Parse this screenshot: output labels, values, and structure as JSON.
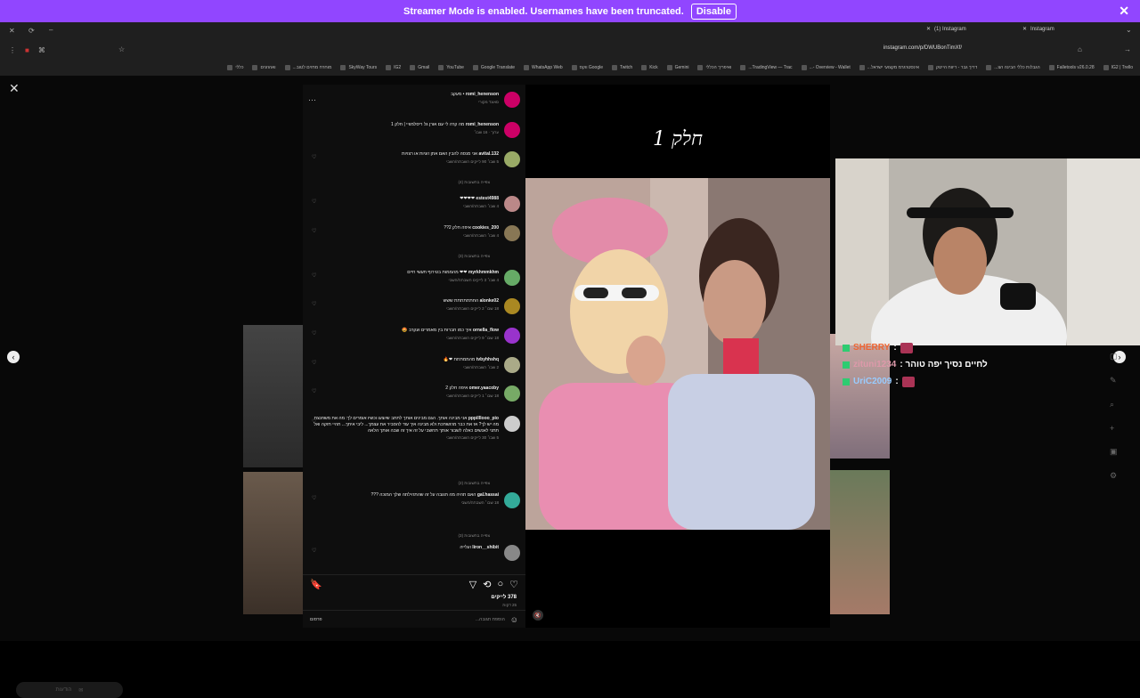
{
  "banner": {
    "message": "Streamer Mode is enabled. Usernames have been truncated.",
    "button_label": "Disable",
    "close": "✕"
  },
  "browser": {
    "tabs": [
      "(1) Instagram",
      "Instagram"
    ],
    "url": "instagram.com/p/DWUBonTimXf/",
    "bookmarks": [
      "IG2 | Trello",
      "Falletools v26.0.28",
      "הגבלות כללי הבינה הצ...",
      "דריך גבר - ריווח הייטק",
      "אינסטרגרמ מקצועי ישראל...",
      "Overview - Wallet -...",
      "TradingView — Trac...",
      "ואיפריך הכללי",
      "Gemini",
      "Kick",
      "Twitch",
      "Google ווקס",
      "WhatsApp Web",
      "Google Translate",
      "YouTube",
      "Gmail",
      "IG2",
      "SkyWay Tours",
      "מוחרח מחזים לטוב...",
      "ואהוזנים",
      "כללי"
    ]
  },
  "post": {
    "caption": "חלק 1",
    "likes": "378 לייקים",
    "ago": "25 דקות",
    "add_comment_placeholder": "הוספת תגובה...",
    "post_label": "פרסום"
  },
  "comments": [
    {
      "user": "romi_henenson",
      "text": "• מעקב",
      "meta": "סאונד מקורי",
      "color": "#c06"
    },
    {
      "user": "romi_henenson",
      "text": "מה קרה לי עם אורן גל ריסלמוויי | חלק 1",
      "meta": "ערוך · 16 שבו׳",
      "color": "#c06"
    },
    {
      "user": "avital.132",
      "text": "אני מנסה להבין האם אתן זוגיות או רצויות",
      "meta": "5 שבו׳ 90 לייקים השבתה/השבי",
      "color": "#9a6"
    },
    {
      "user": "estest4988",
      "text": "❤❤❤❤",
      "meta": "4 שבו׳ השבתה/השבי",
      "color": "#b88"
    },
    {
      "user": "cookies_200",
      "text": "איפה חלק 2??",
      "meta": "4 שבו׳ השבתה/השבי",
      "color": "#875"
    },
    {
      "user": "myrkhmmkhm",
      "text": "❤❤ מהממות בטירוף תעשי חיים",
      "meta": "4 שבו׳ 3 לייקים השבתה/השבי",
      "color": "#6a6"
    },
    {
      "user": "alonke02",
      "text": "החתתתתתת ששש",
      "meta": "18 שבו׳ 2 לייקים השבתה/השבי",
      "color": "#a82"
    },
    {
      "user": "ornella_flow",
      "text": "איך כמו חברות בין מאמרים ועקרב 🤩",
      "meta": "18 שבו׳ 9 לייקים השבתה/השבי",
      "color": "#93c"
    },
    {
      "user": "tvbyhhshq",
      "text": "מהממתתת ❤🔥",
      "meta": "2 שבו׳ השבתה/השבי",
      "color": "#aa8"
    },
    {
      "user": "omer.yaacoby",
      "text": "איפה חלק 2",
      "meta": "18 שבו׳ 1 לייקים השבתה/השבי",
      "color": "#7a6"
    },
    {
      "user": "pppilllooo_pio",
      "text": "אני מבינה אותך. הגם מבינים אותך לתתב שיוצעו וכשיו אומרים לך: מה את משחנצת מה יש לך? אז את כבר מרגשתכת ולא מבינה איך עוד להסביר את עצמך... ליבי איתך... תהיי חזקה ואל תתני לאנשים כאלה לשבור אותך תחשבי על זה איך זה שבה אותך הלאה",
      "meta": "5 שבו׳ 30 לייקים השבתה/השבי",
      "color": "#ccc"
    },
    {
      "user": "gal.hassai",
      "text": "האם תהיה מה תגובה על זה שהתהילתה שלך המוכה ???",
      "meta": "18 שבו׳ השבתה/השבי",
      "color": "#3a9"
    },
    {
      "user": "liron__shibit",
      "text": "ועלייה",
      "meta": "",
      "color": "#888"
    }
  ],
  "view_replies": [
    "צפייה בתשובות (4)",
    "צפייה בתשובות (3)",
    "צפייה בתשובות (2)",
    "צפייה בתשובות (3)"
  ],
  "chat": [
    {
      "user": "SHERRY",
      "text": ":",
      "color": "#e63"
    },
    {
      "user": "zituni1234",
      "text": ": לחיים נסיך יפה טוהר",
      "color": "#d9a"
    },
    {
      "user": "UriC2009",
      "text": ":",
      "color": "#9cf"
    }
  ],
  "hidden_label": "הודעות"
}
